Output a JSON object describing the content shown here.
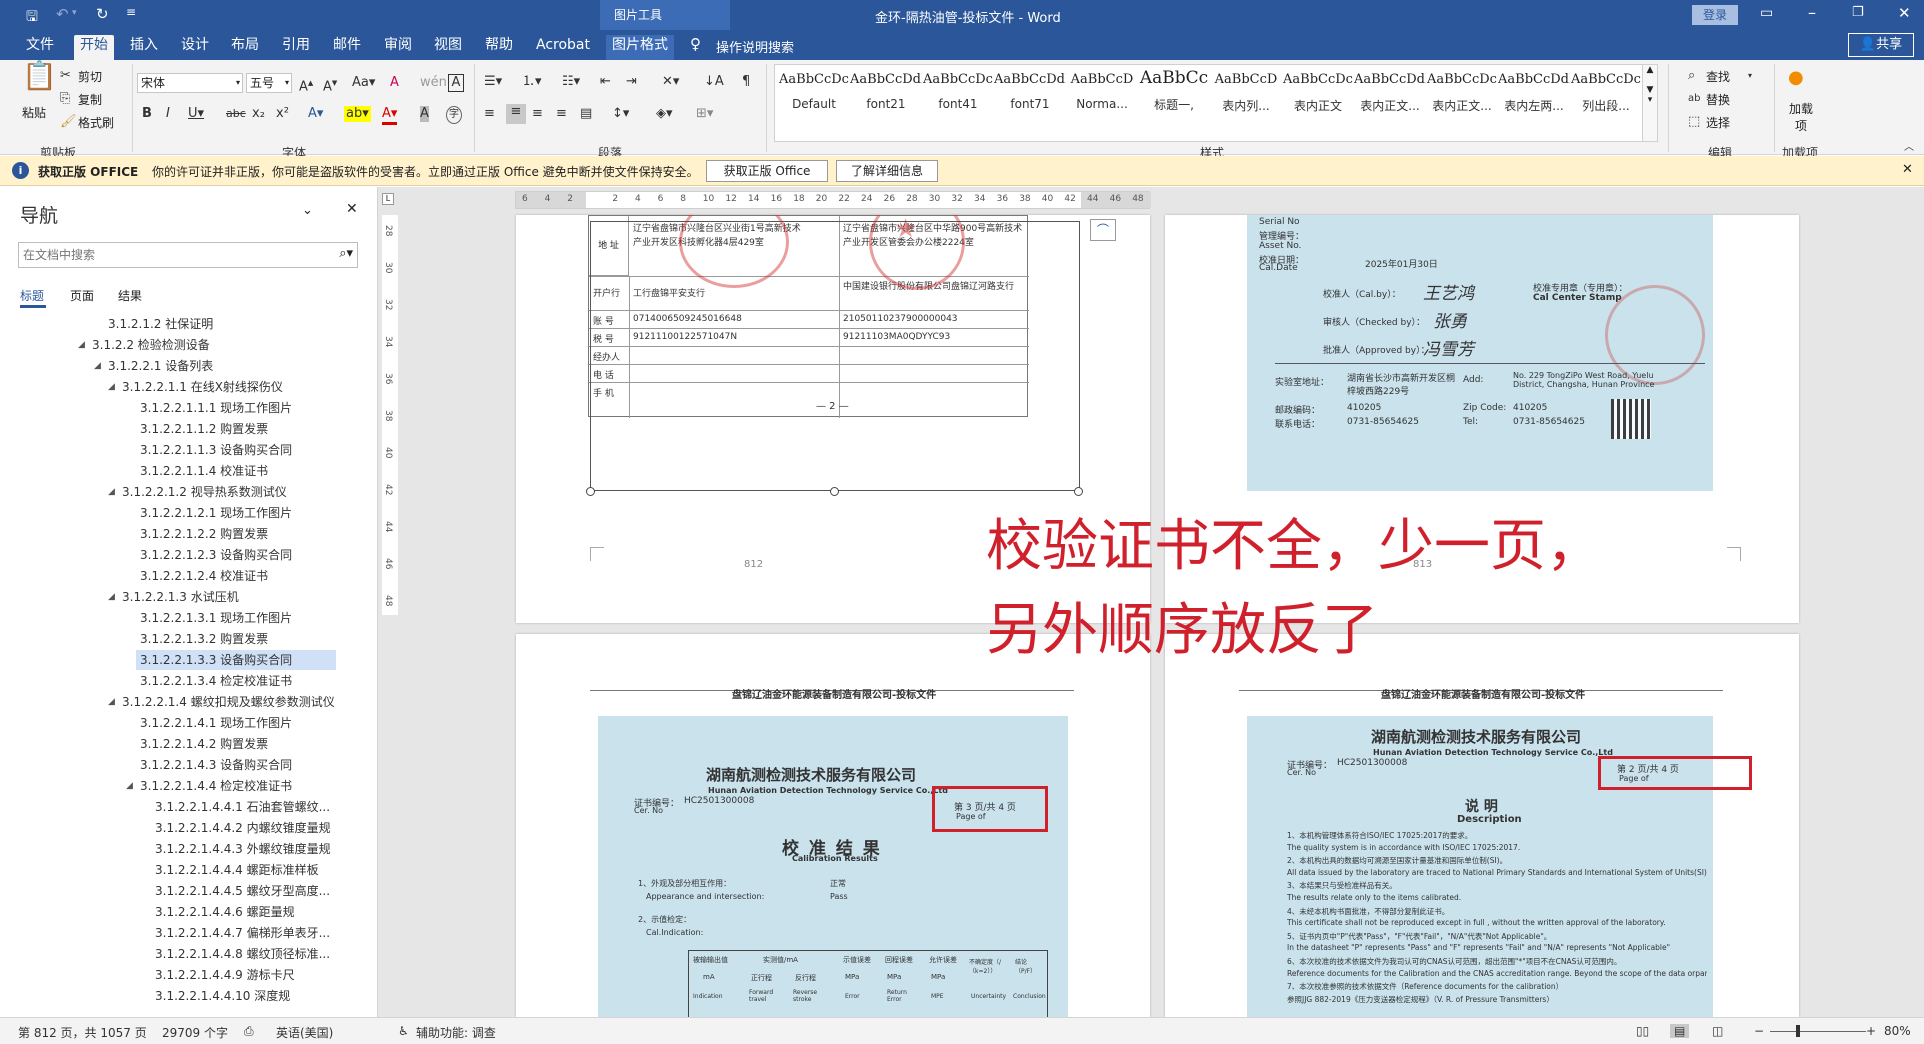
{
  "titlebar": {
    "context_tool": "图片工具",
    "title": "金环-隔热油管-投标文件  -  Word",
    "login": "登录"
  },
  "tabs": [
    "文件",
    "开始",
    "插入",
    "设计",
    "布局",
    "引用",
    "邮件",
    "审阅",
    "视图",
    "帮助",
    "Acrobat",
    "图片格式"
  ],
  "tell_me": "操作说明搜索",
  "share": "共享",
  "ribbon": {
    "clipboard": {
      "paste": "粘贴",
      "cut": "剪切",
      "copy": "复制",
      "format_painter": "格式刷",
      "group": "剪贴板"
    },
    "font": {
      "name": "宋体",
      "size": "五号",
      "group": "字体"
    },
    "paragraph": {
      "group": "段落"
    },
    "styles": {
      "group": "样式",
      "items": [
        {
          "preview": "AaBbCcDc",
          "name": "Default"
        },
        {
          "preview": "AaBbCcDdE",
          "name": "font21"
        },
        {
          "preview": "AaBbCcDc",
          "name": "font41"
        },
        {
          "preview": "AaBbCcDdEe",
          "name": "font71"
        },
        {
          "preview": "AaBbCcD",
          "name": "Norma..."
        },
        {
          "preview": "AaBbCc",
          "name": "标题一,"
        },
        {
          "preview": "AaBbCcD",
          "name": "表内列..."
        },
        {
          "preview": "AaBbCcDc",
          "name": "表内正文"
        },
        {
          "preview": "AaBbCcDdI",
          "name": "表内正文..."
        },
        {
          "preview": "AaBbCcDc",
          "name": "表内正文..."
        },
        {
          "preview": "AaBbCcDdI",
          "name": "表内左两..."
        },
        {
          "preview": "AaBbCcDc",
          "name": "列出段..."
        }
      ]
    },
    "editing": {
      "find": "查找",
      "replace": "替换",
      "select": "选择",
      "group": "编辑"
    },
    "addins": {
      "label": "加载项",
      "group": "加载项"
    }
  },
  "message_bar": {
    "title": "获取正版 OFFICE",
    "text": "你的许可证并非正版，你可能是盗版软件的受害者。立即通过正版 Office 避免中断并使文件保持安全。",
    "btn_get": "获取正版 Office",
    "btn_more": "了解详细信息"
  },
  "nav": {
    "title": "导航",
    "search_placeholder": "在文档中搜索",
    "tabs": [
      "标题",
      "页面",
      "结果"
    ],
    "items": [
      {
        "text": "3.1.2.1.2 社保证明",
        "lvl": 3,
        "tri": false
      },
      {
        "text": "3.1.2.2 检验检测设备",
        "lvl": 2,
        "tri": true
      },
      {
        "text": "3.1.2.2.1 设备列表",
        "lvl": 3,
        "tri": true
      },
      {
        "text": "3.1.2.2.1.1 在线X射线探伤仪",
        "lvl": 4,
        "tri": true
      },
      {
        "text": "3.1.2.2.1.1.1 现场工作图片",
        "lvl": 5,
        "tri": false
      },
      {
        "text": "3.1.2.2.1.1.2 购置发票",
        "lvl": 5,
        "tri": false
      },
      {
        "text": "3.1.2.2.1.1.3 设备购买合同",
        "lvl": 5,
        "tri": false
      },
      {
        "text": "3.1.2.2.1.1.4 校准证书",
        "lvl": 5,
        "tri": false
      },
      {
        "text": "3.1.2.2.1.2 视导热系数测试仪",
        "lvl": 4,
        "tri": true
      },
      {
        "text": "3.1.2.2.1.2.1 现场工作图片",
        "lvl": 5,
        "tri": false
      },
      {
        "text": "3.1.2.2.1.2.2 购置发票",
        "lvl": 5,
        "tri": false
      },
      {
        "text": "3.1.2.2.1.2.3 设备购买合同",
        "lvl": 5,
        "tri": false
      },
      {
        "text": "3.1.2.2.1.2.4 校准证书",
        "lvl": 5,
        "tri": false
      },
      {
        "text": "3.1.2.2.1.3 水试压机",
        "lvl": 4,
        "tri": true
      },
      {
        "text": "3.1.2.2.1.3.1 现场工作图片",
        "lvl": 5,
        "tri": false
      },
      {
        "text": "3.1.2.2.1.3.2 购置发票",
        "lvl": 5,
        "tri": false
      },
      {
        "text": "3.1.2.2.1.3.3 设备购买合同",
        "lvl": 5,
        "tri": false,
        "selected": true
      },
      {
        "text": "3.1.2.2.1.3.4 检定校准证书",
        "lvl": 5,
        "tri": false
      },
      {
        "text": "3.1.2.2.1.4 螺纹扣规及螺纹参数测试仪",
        "lvl": 4,
        "tri": true
      },
      {
        "text": "3.1.2.2.1.4.1 现场工作图片",
        "lvl": 5,
        "tri": false
      },
      {
        "text": "3.1.2.2.1.4.2 购置发票",
        "lvl": 5,
        "tri": false
      },
      {
        "text": "3.1.2.2.1.4.3 设备购买合同",
        "lvl": 5,
        "tri": false
      },
      {
        "text": "3.1.2.2.1.4.4 检定校准证书",
        "lvl": 5,
        "tri": true
      },
      {
        "text": "3.1.2.2.1.4.4.1 石油套管螺纹...",
        "lvl": 6,
        "tri": false
      },
      {
        "text": "3.1.2.2.1.4.4.2 内螺纹锥度量规",
        "lvl": 6,
        "tri": false
      },
      {
        "text": "3.1.2.2.1.4.4.3 外螺纹锥度量规",
        "lvl": 6,
        "tri": false
      },
      {
        "text": "3.1.2.2.1.4.4.4 螺距标准样板",
        "lvl": 6,
        "tri": false
      },
      {
        "text": "3.1.2.2.1.4.4.5 螺纹牙型高度...",
        "lvl": 6,
        "tri": false
      },
      {
        "text": "3.1.2.2.1.4.4.6 螺距量规",
        "lvl": 6,
        "tri": false
      },
      {
        "text": "3.1.2.2.1.4.4.7 偏梯形单表牙...",
        "lvl": 6,
        "tri": false
      },
      {
        "text": "3.1.2.2.1.4.4.8 螺纹顶径标准...",
        "lvl": 6,
        "tri": false
      },
      {
        "text": "3.1.2.2.1.4.4.9 游标卡尺",
        "lvl": 6,
        "tri": false
      },
      {
        "text": "3.1.2.2.1.4.4.10 深度规",
        "lvl": 6,
        "tri": false
      }
    ]
  },
  "document": {
    "page_left_top": {
      "address_label": "地  址",
      "address_left": "辽宁省盘锦市兴隆台区兴业街1号高新技术产业开发区科技孵化器4层429室",
      "address_right": "辽宁省盘锦市兴隆台区中华路900号高新技术产业开发区管委会办公楼2224室",
      "bank_label": "开户行",
      "bank_left": "工行盘锦平安支行",
      "bank_right": "中国建设银行股份有限公司盘锦辽河路支行",
      "account_label": "账  号",
      "account_left": "0714006509245016648",
      "account_right": "21050110237900000043",
      "tax_label": "税  号",
      "tax_left": "91211100122571047N",
      "tax_right": "91211103MA0QDYYC93",
      "agent_label": "经办人",
      "phone_label": "电  话",
      "mobile_label": "手  机",
      "page_mark": "— 2 —",
      "page_num": "812"
    },
    "page_right_top": {
      "serial": "Serial No",
      "mgmt": "管理编号：",
      "asset": "Asset No.",
      "caldate_label": "校准日期：",
      "caldate_en": "Cal.Date",
      "caldate": "2025年01月30日",
      "cal_by": "校准人（Cal.by）：",
      "checked_by": "审核人（Checked by）：",
      "approved_by": "批准人（Approved by）：",
      "sign1": "王艺鸿",
      "sign2": "张勇",
      "sign3": "冯雪芳",
      "center_stamp_cn": "校准专用章（专用章）：",
      "center_stamp": "Cal Center Stamp",
      "address_cn_label": "实验室地址：",
      "address_cn": "湖南省长沙市高新开发区桐梓坡西路229号",
      "address_en_label": "Add:",
      "address_en": "No. 229 TongZiPo West Road, Yuelu District, Changsha, Hunan Province",
      "postcode_label": "邮政编码：",
      "postcode": "410205",
      "zip_label": "Zip Code:",
      "zip": "410205",
      "tel_label": "联系电话：",
      "tel": "0731-85654625",
      "tel_en_label": "Tel:",
      "page_num": "813"
    },
    "page_left_bottom": {
      "header": "盘锦辽油金环能源装备制造有限公司-投标文件",
      "company": "湖南航测检测技术服务有限公司",
      "company_en": "Hunan Aviation Detection Technology Service Co.,Ltd",
      "cert_no_label": "证书编号：",
      "cert_no": "HC2501300008",
      "cer_no": "Cer. No",
      "page_info": "第 3 页/共 4 页",
      "page_of": "Page    of",
      "section": "校 准 结 果",
      "section_en": "Calibration Results",
      "item1": "1、外观及部分相互作用：",
      "item1_en": "Appearance and intersection:",
      "item1_cn_val": "正常",
      "item1_val": "Pass",
      "item2": "2、示值检定：",
      "item2_en": "Cal.Indication:",
      "tbl_h1": "被输输出值",
      "tbl_h2": "实测值/mA",
      "tbl_h3": "示值误差",
      "tbl_h4": "回程误差",
      "tbl_h5": "允许误差",
      "tbl_h6": "不确定度（/（k=2））",
      "tbl_h7": "结论（P/F）",
      "tbl_u1": "mA",
      "tbl_u2": "正行程",
      "tbl_u3": "反行程",
      "tbl_u4": "MPa",
      "tbl_u5": "MPa",
      "tbl_u6": "MPa",
      "tbl_e1": "Indication",
      "tbl_e2": "Forward travel",
      "tbl_e3": "Reverse stroke",
      "tbl_e4": "Error",
      "tbl_e5": "Return Error",
      "tbl_e6": "MPE",
      "tbl_e7": "Uncertainty",
      "tbl_e8": "Conclusion"
    },
    "page_right_bottom": {
      "header": "盘锦辽油金环能源装备制造有限公司-投标文件",
      "company": "湖南航测检测技术服务有限公司",
      "company_en": "Hunan Aviation Detection Technology Service Co.,Ltd",
      "cert_no_label": "证书编号：",
      "cert_no": "HC2501300008",
      "cer_no": "Cer. No",
      "page_info": "第 2 页/共 4 页",
      "page_of": "Page    of",
      "section": "说  明",
      "section_en": "Description",
      "lines": [
        "1、本机构管理体系符合ISO/IEC 17025:2017的要求。",
        "The quality system is in accordance with ISO/IEC 17025:2017.",
        "2、本机构出具的数据均可溯源至国家计量基准和国际单位制(SI)。",
        "All data issued by the laboratory are traced to National Primary Standards and International System of Units(SI).",
        "3、本结果只与受检准样品有关。",
        "The results relate only to the items calibrated.",
        "4、未经本机构书面批准，不得部分复制此证书。",
        "This certificate shall not be reproduced except in full , without the written approval of the laboratory.",
        "5、证书内页中\"P\"代表\"Pass\"，\"F\"代表\"Fail\"，\"N/A\"代表\"Not Applicable\"。",
        "In the datasheet \"P\" represents \"Pass\" and \"F\" represents \"Fail\" and \"N/A\" represents \"Not Applicable\"",
        "6、本次校准的技术依据文件为我司认可的CNAS认可范围，超出范围\"*\"项目不在CNAS认可范围内。",
        "Reference documents for the Calibration and the CNAS accreditation range. Beyond the scope of the data orparameter with asterisk \"*\" is not within the accreditation by CNAS.",
        "7、本次校准参照的技术依据文件（Reference documents for the calibration）",
        "参照JJG 882-2019《压力变送器检定规程》（V. R. of Pressure Transmitters）"
      ]
    },
    "annotation": [
      "校验证书不全，少一页，",
      "另外顺序放反了"
    ]
  },
  "ruler_numbers": [
    "6",
    "4",
    "2",
    "",
    "2",
    "4",
    "6",
    "8",
    "10",
    "12",
    "14",
    "16",
    "18",
    "20",
    "22",
    "24",
    "26",
    "28",
    "30",
    "32",
    "34",
    "36",
    "38",
    "40",
    "42",
    "44",
    "46",
    "48"
  ],
  "vruler_numbers": [
    "28",
    "30",
    "32",
    "34",
    "36",
    "38",
    "40",
    "42",
    "44",
    "46",
    "48"
  ],
  "statusbar": {
    "page": "第 812 页，共 1057 页",
    "words": "29709 个字",
    "lang": "英语(美国)",
    "accessibility": "辅助功能: 调查",
    "zoom": "80%"
  },
  "colors": {
    "accent": "#2b579a",
    "annotation": "#d0202c",
    "scan": "#c9e2ec",
    "message_bar": "#fff2cc"
  }
}
